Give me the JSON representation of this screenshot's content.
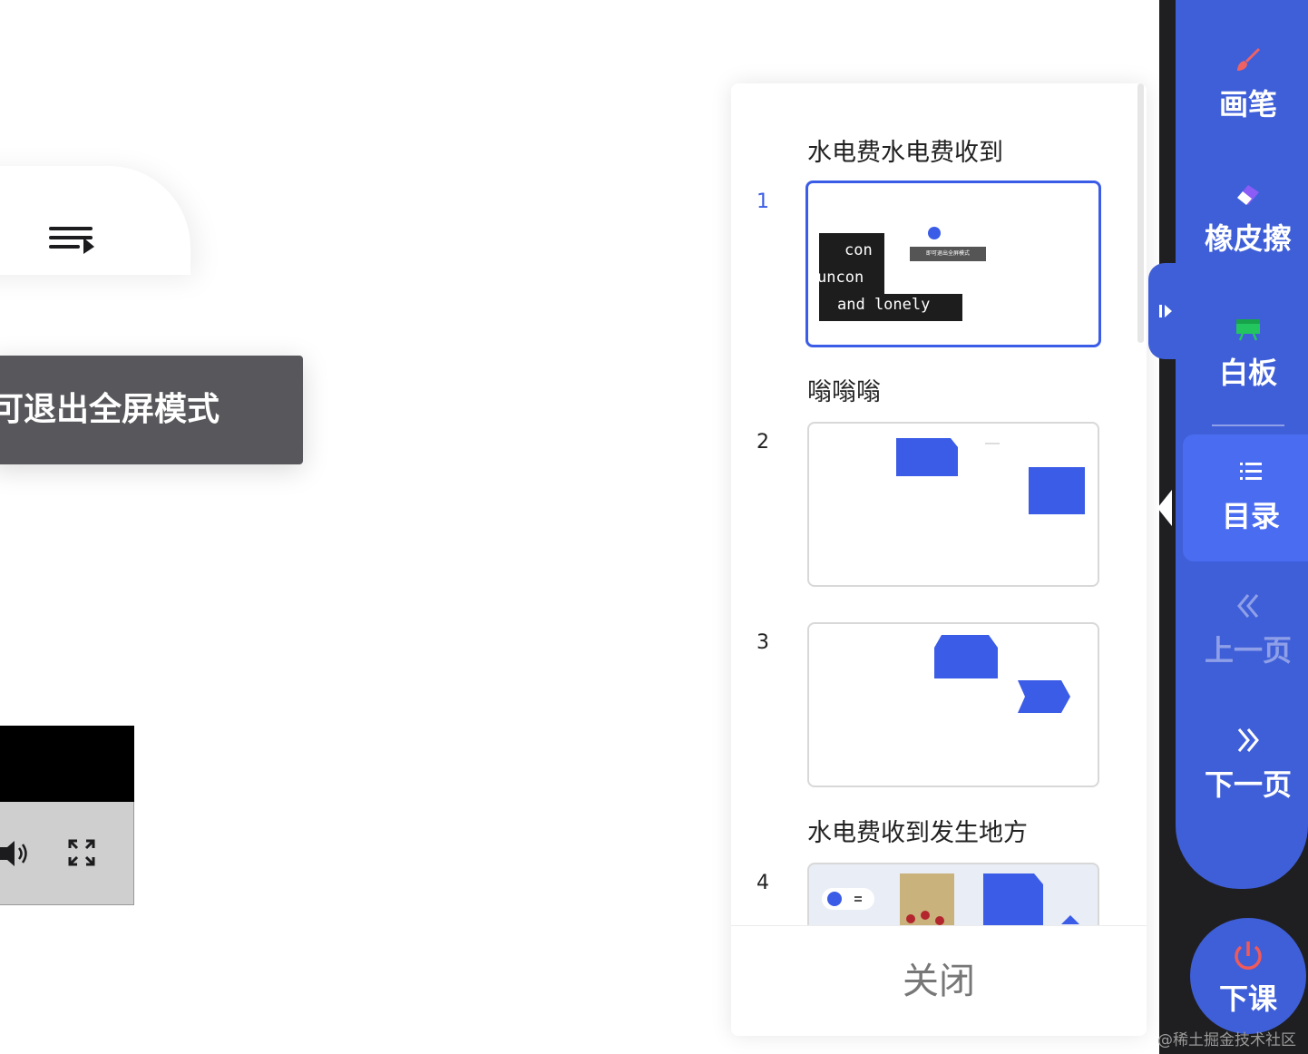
{
  "toast": {
    "text": "可退出全屏模式"
  },
  "catalog": {
    "sections": [
      {
        "title": "水电费水电费收到"
      },
      {
        "title": "嗡嗡嗡"
      },
      {
        "title": "水电费收到发生地方"
      }
    ],
    "slides": [
      {
        "number": "1",
        "active": true,
        "thumb_text": [
          "con",
          "uncon",
          "and lonely"
        ],
        "thumb_label": "即可退出全屏模式"
      },
      {
        "number": "2",
        "active": false
      },
      {
        "number": "3",
        "active": false
      },
      {
        "number": "4",
        "active": false
      }
    ],
    "close_label": "关闭"
  },
  "toolbar": {
    "brush_label": "画笔",
    "eraser_label": "橡皮擦",
    "whiteboard_label": "白板",
    "catalog_label": "目录",
    "prev_label": "上一页",
    "next_label": "下一页",
    "end_label": "下课"
  },
  "colors": {
    "accent": "#3f5fd8",
    "active": "#4a6cf0",
    "brush": "#f06262",
    "eraser": "#8b5cf6",
    "whiteboard": "#22c55e",
    "power": "#f05a5a"
  },
  "watermark": "@稀土掘金技术社区"
}
